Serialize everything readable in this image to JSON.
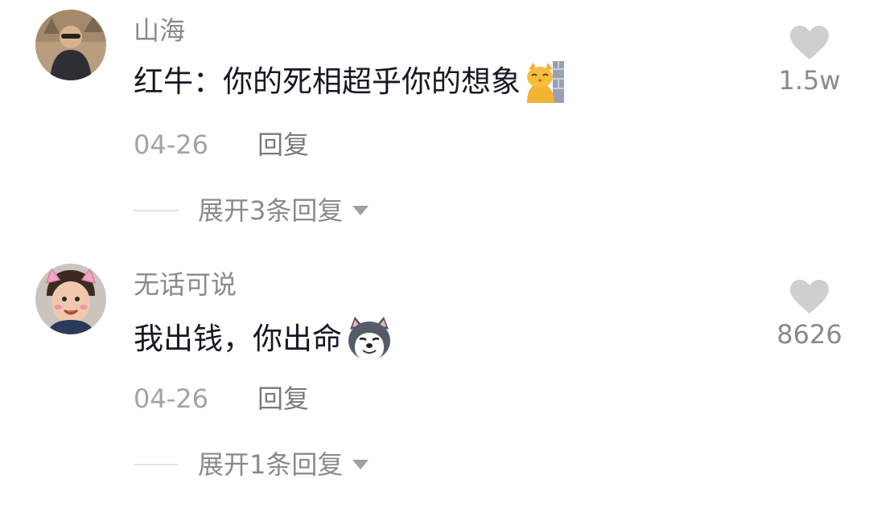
{
  "comments": [
    {
      "username": "山海",
      "text": "红牛：你的死相超乎你的想象",
      "emoji": "peeking-cat-emoji",
      "date": "04-26",
      "reply_label": "回复",
      "expand_label": "展开3条回复",
      "likes": "1.5w"
    },
    {
      "username": "无话可说",
      "text": "我出钱，你出命",
      "emoji": "husky-dog-emoji",
      "date": "04-26",
      "reply_label": "回复",
      "expand_label": "展开1条回复",
      "likes": "8626"
    }
  ],
  "colors": {
    "username": "#8a8a8a",
    "text": "#161823",
    "meta": "#a3a3a3",
    "heart": "#cfcfcf"
  },
  "icons": {
    "like": "heart-icon",
    "expand": "caret-down-icon"
  }
}
